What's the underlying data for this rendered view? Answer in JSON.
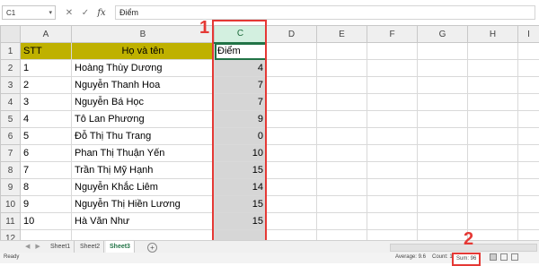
{
  "formula_bar": {
    "name_box": "C1",
    "fx_label": "fx",
    "cancel_symbol": "✕",
    "enter_symbol": "✓",
    "content": "Điểm"
  },
  "columns": [
    "A",
    "B",
    "C",
    "D",
    "E",
    "F",
    "G",
    "H",
    "I"
  ],
  "header_row": {
    "stt": "STT",
    "name": "Họ và tên",
    "score": "Điểm"
  },
  "rows": [
    {
      "stt": "1",
      "name": "Hoàng Thùy Dương",
      "score": "4"
    },
    {
      "stt": "2",
      "name": "Nguyễn Thanh Hoa",
      "score": "7"
    },
    {
      "stt": "3",
      "name": "Nguyễn Bá Học",
      "score": "7"
    },
    {
      "stt": "4",
      "name": "Tô Lan Phương",
      "score": "9"
    },
    {
      "stt": "5",
      "name": "Đỗ Thị Thu Trang",
      "score": "0"
    },
    {
      "stt": "6",
      "name": "Phan Thị Thuận Yến",
      "score": "10"
    },
    {
      "stt": "7",
      "name": "Trần Thị Mỹ Hạnh",
      "score": "15"
    },
    {
      "stt": "8",
      "name": "Nguyễn Khắc Liêm",
      "score": "14"
    },
    {
      "stt": "9",
      "name": "Nguyễn Thị Hiền Lương",
      "score": "15"
    },
    {
      "stt": "10",
      "name": "Hà Văn Như",
      "score": "15"
    }
  ],
  "row_numbers": [
    "1",
    "2",
    "3",
    "4",
    "5",
    "6",
    "7",
    "8",
    "9",
    "10",
    "11",
    "12"
  ],
  "annotations": {
    "one": "1",
    "two": "2"
  },
  "sheets": [
    "Sheet1",
    "Sheet2",
    "Sheet3"
  ],
  "active_sheet": "Sheet3",
  "status": {
    "ready": "Ready",
    "average": "Average: 9.6",
    "count": "Count: 11",
    "sum": "Sum: 96"
  },
  "colors": {
    "header_fill": "#bfb100",
    "highlight": "#e53935",
    "accent": "#217346"
  }
}
